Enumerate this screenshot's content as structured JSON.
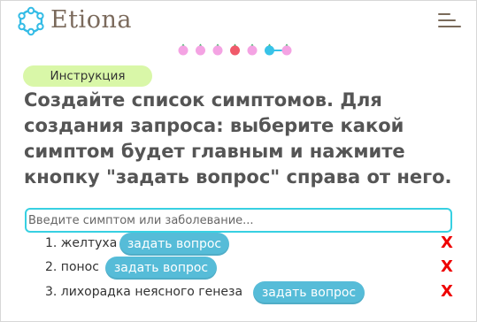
{
  "header": {
    "brand": "Etiona",
    "logo_icon": "etiona-logo-icon",
    "menu_icon": "hamburger-menu-icon"
  },
  "progress": {
    "colors": [
      "#f4a3e3",
      "#f4a3e3",
      "#f4a3e3",
      "#f05a6a",
      "#f4a3e3",
      "#38c3e8",
      "#f4a3e3"
    ],
    "current": 4
  },
  "instruction": {
    "badge": "Инструкция",
    "text": " Создайте список симптомов. Для создания запроса: выберите какой симптом будет главным и нажмите кнопку \"задать вопрос\" справа от него."
  },
  "search": {
    "placeholder": "Введите симптом или заболевание...",
    "value": ""
  },
  "symptoms": [
    {
      "label": "1. желтуха",
      "button": "задать вопрос",
      "remove": "X"
    },
    {
      "label": "2. понос",
      "button": "задать вопрос",
      "remove": "X"
    },
    {
      "label": "3. лихорадка неясного генеза",
      "button": "задать вопрос",
      "remove": "X"
    }
  ],
  "colors": {
    "brand": "#7b6a5c",
    "accent_button": "#56bcd8",
    "badge_bg": "#d9f7a8",
    "input_border": "#37d0e2",
    "remove": "#ee0000"
  }
}
